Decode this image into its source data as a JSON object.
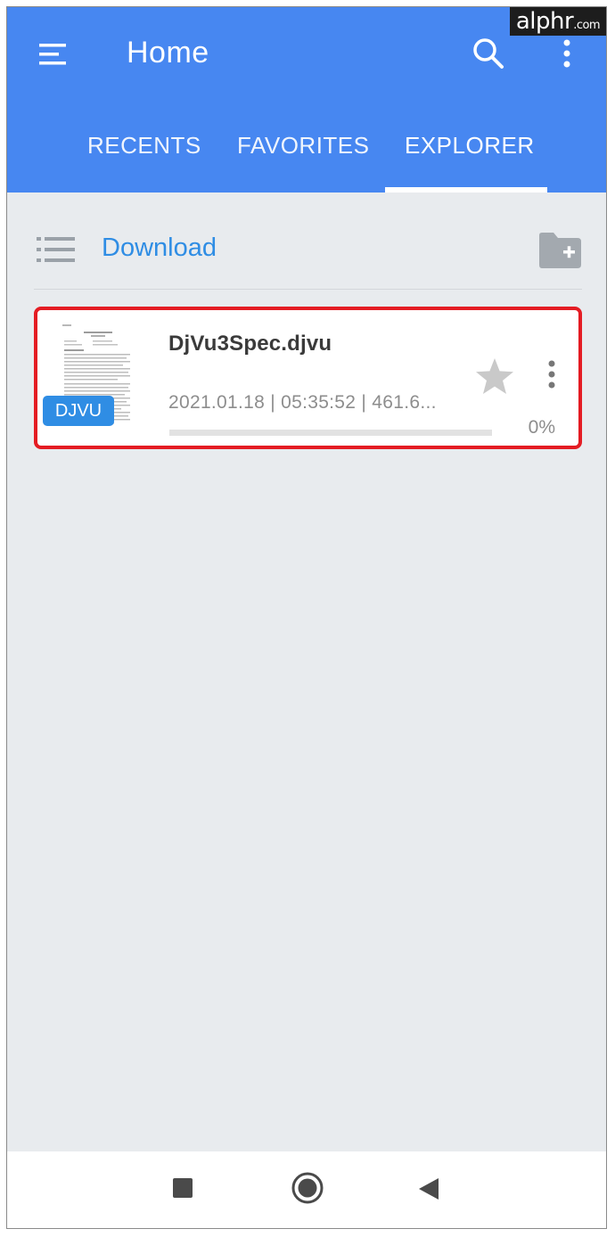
{
  "watermark": {
    "brand": "alphr",
    "suffix": ".com"
  },
  "appbar": {
    "title": "Home",
    "background_color": "#4787f1",
    "menu_icon": "hamburger-menu-icon",
    "search_icon": "search-icon",
    "more_icon": "more-vertical-icon"
  },
  "tabs": [
    {
      "label": "RECENTS",
      "active": false
    },
    {
      "label": "FAVORITES",
      "active": false
    },
    {
      "label": "EXPLORER",
      "active": true
    }
  ],
  "pathbar": {
    "view_icon": "list-view-icon",
    "current_folder": "Download",
    "new_folder_icon": "new-folder-icon",
    "accent_color": "#2f8de4"
  },
  "files": [
    {
      "name": "DjVu3Spec.djvu",
      "type_badge": "DJVU",
      "meta": "2021.01.18 | 05:35:52 | 461.6...",
      "progress_percent": 0,
      "progress_text": "0%",
      "favorite_icon": "star-icon",
      "more_icon": "more-vertical-icon",
      "highlight_color": "#e41c23"
    }
  ],
  "navbar": {
    "recents_icon": "square-recents-icon",
    "home_icon": "circle-home-icon",
    "back_icon": "triangle-back-icon"
  }
}
